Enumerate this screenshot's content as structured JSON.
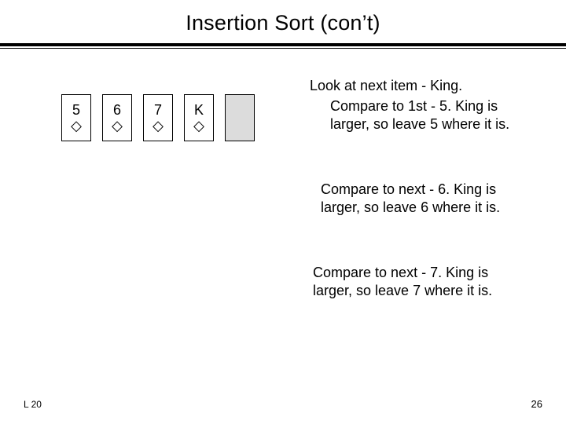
{
  "title": "Insertion Sort (con’t)",
  "cards": [
    {
      "rank": "5",
      "suit": "◇"
    },
    {
      "rank": "6",
      "suit": "◇"
    },
    {
      "rank": "7",
      "suit": "◇"
    },
    {
      "rank": "K",
      "suit": "◇"
    }
  ],
  "heading": "Look at next item - King.",
  "paragraphs": {
    "p1": "Compare to 1st - 5. King is larger, so leave 5 where it is.",
    "p2": "Compare to next - 6. King is larger, so leave 6 where it is.",
    "p3": "Compare to next - 7. King is larger, so leave 7 where it is."
  },
  "footer": {
    "left": "L 20",
    "right": "26"
  }
}
